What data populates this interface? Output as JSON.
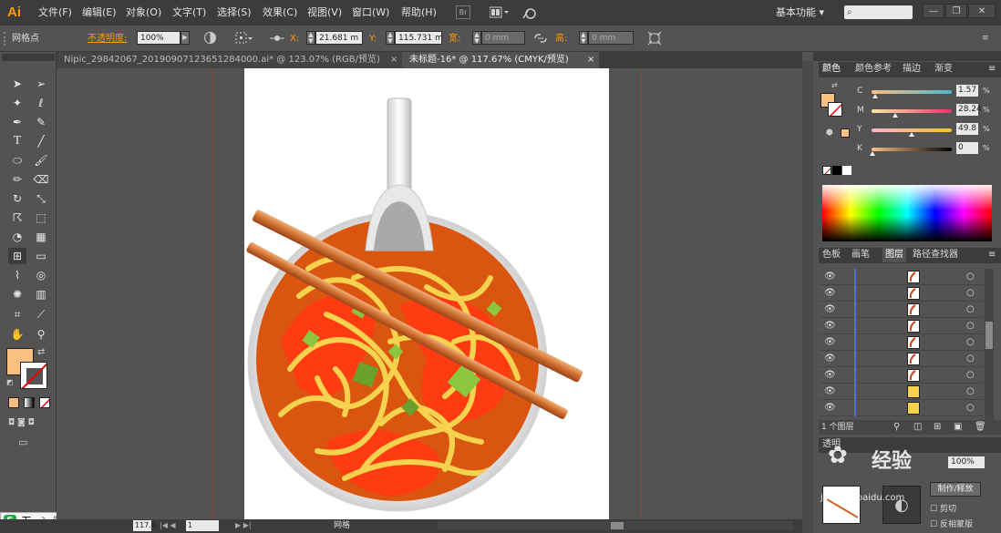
{
  "app": {
    "logo": "Ai"
  },
  "menu": {
    "items": [
      "文件(F)",
      "编辑(E)",
      "对象(O)",
      "文字(T)",
      "选择(S)",
      "效果(C)",
      "视图(V)",
      "窗口(W)",
      "帮助(H)"
    ],
    "workspace": "基本功能",
    "workspace_arrow": "▾",
    "search_placeholder": "",
    "icons": [
      "bridge-icon",
      "arrange-documents-icon",
      "gpu-performance-icon"
    ]
  },
  "control": {
    "selection_label": "网格点",
    "opacity_label": "不透明度:",
    "opacity_value": "100%",
    "x_label": "X:",
    "x_value": "21.681 m",
    "y_label": "Y:",
    "y_value": "115.731 m",
    "w_label": "宽:",
    "w_value": "0 mm",
    "h_label": "高:",
    "h_value": "0 mm"
  },
  "tabs": [
    {
      "label": "Nipic_29842067_20190907123651284000.ai* @ 123.07% (RGB/预览)",
      "close": "×",
      "active": false
    },
    {
      "label": "未标题-16* @ 117.67% (CMYK/预览)",
      "close": "×",
      "active": true
    }
  ],
  "color_panel": {
    "tabs": [
      "颜色",
      "颜色参考",
      "描边",
      "渐变"
    ],
    "channels": [
      {
        "name": "C",
        "value": "1.57",
        "unit": "%",
        "pos": 0.02
      },
      {
        "name": "M",
        "value": "28.24",
        "unit": "%",
        "pos": 0.28
      },
      {
        "name": "Y",
        "value": "49.8",
        "unit": "%",
        "pos": 0.5
      },
      {
        "name": "K",
        "value": "0",
        "unit": "%",
        "pos": 0.0
      }
    ],
    "fill_color": "#fbbf82"
  },
  "layers_panel": {
    "tabs": [
      "色板",
      "画笔",
      "图层",
      "路径查找器"
    ],
    "active_tab": "图层",
    "footer": "1 个图层"
  },
  "preview_panel": {
    "watermark": "经验",
    "watermark_sub": "jingyan.baidu.com",
    "buttons": [
      "制作/释放"
    ],
    "options": [
      "剪切",
      "反相蒙版"
    ],
    "opacity_value": "100%"
  },
  "status": {
    "zoom": "117.6",
    "page": "1",
    "mode": "网格"
  },
  "ime": {
    "items": [
      "五",
      "☽",
      "°,",
      "⌨",
      "👕",
      "🔧"
    ]
  },
  "colors": {
    "accent": "#ff9a00",
    "soup": "#e0530d",
    "noodle": "#f5d44b",
    "chopstick": "#c8652a",
    "bowl_rim": "#dcdcdc",
    "green": "#8cc63f"
  }
}
